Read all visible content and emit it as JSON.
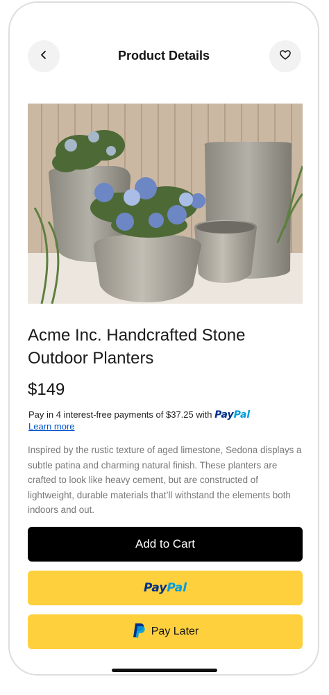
{
  "header": {
    "title": "Product Details",
    "back_icon": "chevron-left-icon",
    "favorite_icon": "heart-icon"
  },
  "product": {
    "image_alt": "Stone outdoor planters with hydrangeas",
    "title": "Acme Inc. Handcrafted Stone Outdoor Planters",
    "price": "$149",
    "description": "Inspired by the rustic texture of aged limestone, Sedona displays a subtle patina and charming natural finish. These planters are crafted to look like heavy cement, but are constructed of lightweight, durable materials that’ll withstand the elements both indoors and out."
  },
  "paypal_message": {
    "text": "Pay in 4 interest-free payments of $37.25 with ",
    "brand_pay": "Pay",
    "brand_pal": "Pal",
    "link": "Learn more"
  },
  "actions": {
    "add_to_cart": "Add to Cart",
    "paypal_pay": "Pay",
    "paypal_pal": "Pal",
    "pay_later": "Pay Later",
    "pay_later_icon": "paypal-p-icon"
  },
  "colors": {
    "cart_button": "#000000",
    "paypal_button": "#ffd03e",
    "paypal_dark_blue": "#003087",
    "paypal_light_blue": "#009cde",
    "link": "#0052cc"
  }
}
